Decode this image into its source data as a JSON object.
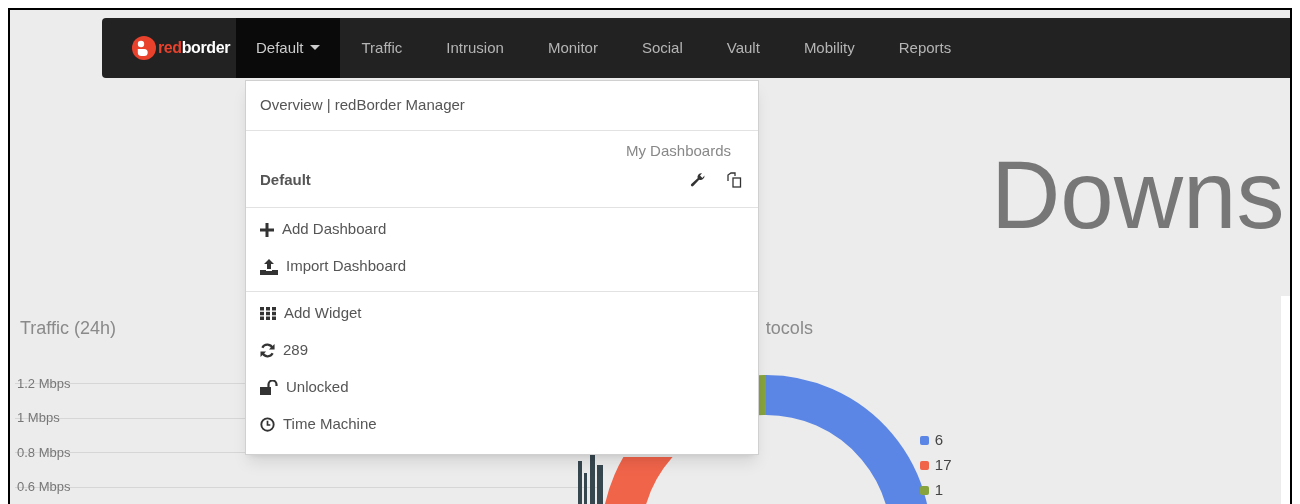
{
  "navbar": {
    "brand": {
      "parts": [
        "red",
        "border"
      ]
    },
    "items": [
      {
        "label": "Default",
        "selected": true,
        "dropdown": true
      },
      {
        "label": "Traffic",
        "selected": false,
        "dropdown": false
      },
      {
        "label": "Intrusion",
        "selected": false,
        "dropdown": false
      },
      {
        "label": "Monitor",
        "selected": false,
        "dropdown": false
      },
      {
        "label": "Social",
        "selected": false,
        "dropdown": false
      },
      {
        "label": "Vault",
        "selected": false,
        "dropdown": false
      },
      {
        "label": "Mobility",
        "selected": false,
        "dropdown": false
      },
      {
        "label": "Reports",
        "selected": false,
        "dropdown": false
      }
    ]
  },
  "dashboard_menu": {
    "title": "Overview | redBorder Manager",
    "section_label": "My Dashboards",
    "dashboards": [
      {
        "name": "Default"
      }
    ],
    "dashboard_actions": [
      "Add Dashboard",
      "Import Dashboard"
    ],
    "widget_actions": [
      "Add Widget",
      "289",
      "Unlocked",
      "Time Machine"
    ]
  },
  "page_heading": "Downs",
  "traffic_widget": {
    "title": "Traffic (24h)",
    "y_axis_labels": [
      "1.2 Mbps",
      "1 Mbps",
      "0.8 Mbps",
      "0.6 Mbps"
    ]
  },
  "protocols_widget": {
    "title": "tocols",
    "legend": [
      {
        "label": "6",
        "color": "#5b86e5"
      },
      {
        "label": "17",
        "color": "#f0644a"
      },
      {
        "label": "1",
        "color": "#86a33e"
      }
    ]
  }
}
